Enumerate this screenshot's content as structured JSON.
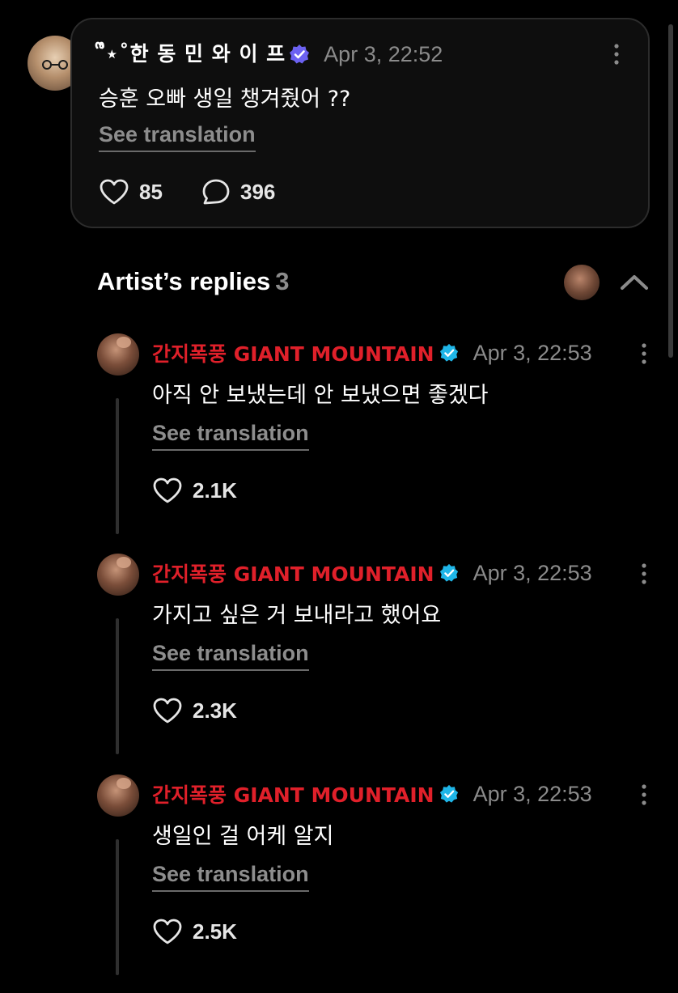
{
  "post": {
    "author": "˚ᩚ⋆˚한 동 민 와 이 프",
    "timestamp": "Apr 3, 22:52",
    "text": "승훈 오빠 생일 챙겨줬어 ??",
    "translate_label": "See translation",
    "likes": "85",
    "comments": "396",
    "icons": {
      "badge": "purple-verified-badge-icon",
      "like": "heart-icon",
      "comment": "speech-bubble-icon",
      "menu": "more-vertical-icon"
    }
  },
  "replies_section": {
    "title": "Artist’s replies",
    "count": "3",
    "collapse_icon": "chevron-up-icon"
  },
  "replies": [
    {
      "artist_name": "간지폭풍 GIANT MOUNTAIN",
      "timestamp": "Apr 3, 22:53",
      "text": "아직 안 보냈는데 안 보냈으면 좋겠다",
      "translate_label": "See translation",
      "likes": "2.1K"
    },
    {
      "artist_name": "간지폭풍 GIANT MOUNTAIN",
      "timestamp": "Apr 3, 22:53",
      "text": "가지고 싶은 거 보내라고 했어요",
      "translate_label": "See translation",
      "likes": "2.3K"
    },
    {
      "artist_name": "간지폭풍 GIANT MOUNTAIN",
      "timestamp": "Apr 3, 22:53",
      "text": "생일인 걸 어케 알지",
      "translate_label": "See translation",
      "likes": "2.5K"
    }
  ],
  "colors": {
    "background": "#000000",
    "artist_name": "#e0202a",
    "muted": "#8b8b8b",
    "verified_blue": "#1fb6e8",
    "verified_purple": "#6c62f2"
  }
}
